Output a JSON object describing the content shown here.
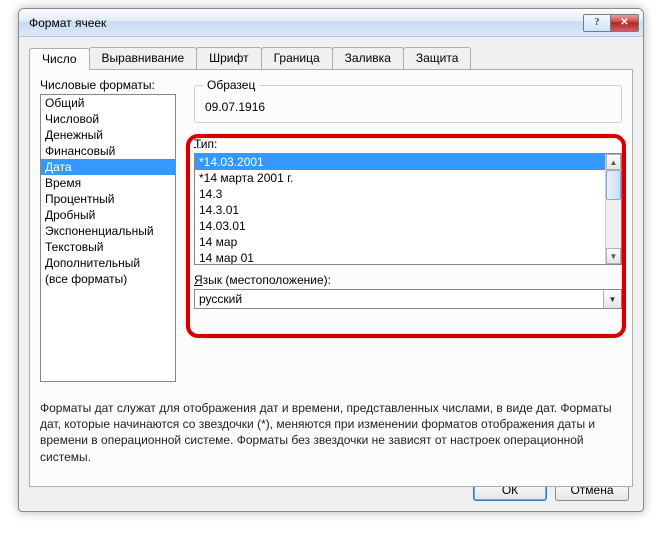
{
  "window": {
    "title": "Формат ячеек",
    "help_glyph": "?",
    "close_glyph": "✕"
  },
  "tabs": [
    {
      "id": "number",
      "label": "Число"
    },
    {
      "id": "align",
      "label": "Выравнивание"
    },
    {
      "id": "font",
      "label": "Шрифт"
    },
    {
      "id": "border",
      "label": "Граница"
    },
    {
      "id": "fill",
      "label": "Заливка"
    },
    {
      "id": "protect",
      "label": "Защита"
    }
  ],
  "active_tab": "number",
  "category_label": "Числовые форматы:",
  "categories": [
    "Общий",
    "Числовой",
    "Денежный",
    "Финансовый",
    "Дата",
    "Время",
    "Процентный",
    "Дробный",
    "Экспоненциальный",
    "Текстовый",
    "Дополнительный",
    "(все форматы)"
  ],
  "selected_category_index": 4,
  "sample": {
    "label": "Образец",
    "value": "09.07.1916"
  },
  "type": {
    "label": "Тип:",
    "selected_index": 0,
    "options": [
      "*14.03.2001",
      "*14 марта 2001 г.",
      "14.3",
      "14.3.01",
      "14.03.01",
      "14 мар",
      "14 мар 01"
    ]
  },
  "locale": {
    "label_pre": "Я",
    "label_post": "зык (местоположение):",
    "value": "русский"
  },
  "help_text": "Форматы дат служат для отображения дат и времени, представленных числами, в виде дат. Форматы дат, которые начинаются со звездочки (*), меняются при изменении форматов отображения даты и времени в операционной системе. Форматы без звездочки не зависят от настроек операционной системы.",
  "buttons": {
    "ok": "ОК",
    "cancel": "Отмена"
  },
  "scrollbar": {
    "up": "▲",
    "down": "▼"
  },
  "combo_arrow": "▼"
}
